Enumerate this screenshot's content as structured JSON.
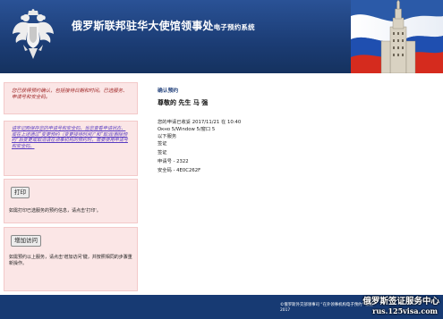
{
  "header": {
    "title_main": "俄罗斯联邦驻华大使馆领事处",
    "title_sub": "电子预约系统",
    "emblem_icon": "double-headed-eagle-icon",
    "flag_icon": "russian-flag-building-icon",
    "colors": {
      "header_bg": "#1b3c74",
      "flag_white": "#ffffff",
      "flag_blue": "#1f4fb0",
      "flag_red": "#d52b1e"
    }
  },
  "sidebar": {
    "notice": "您已获得预约确认，包括接待日期和时间。已选服务、申请号和安全码。",
    "edit_link": "请牢记刚保存您的申请号和安全码，当您查看申请状态、或在上述通过“变更预约（变更接待时间）”和“取消/删除预约”后变更或取消请在领事机构的预约时，需要使用申请号和安全码。",
    "print_button": "打印",
    "print_desc": "如需打印已选服务的预约信息，请点击'打印'。",
    "add_button": "增加访问",
    "add_desc": "如需预约以上服务，请点击'增加访问'键，并按照相同的步骤重新操作。"
  },
  "main": {
    "confirm_label": "确认预约",
    "greeting": "尊敬的 先生 马 强",
    "lines": [
      "您的申请已收妥 2017/11/21 在 10:40",
      "Окно 5/Window 5/窗口 5",
      "以下服务",
      "签证",
      "签证",
      "申请号 - 2322",
      "安全码 - 4E0C262F"
    ]
  },
  "footer": {
    "text_line1": "©俄罗斯外交部领事司 “在外领事机构电子预约” 系统",
    "text_line2": "2017"
  },
  "watermark": {
    "line1": "俄罗斯签证服务中心",
    "line2": "rus.125visa.com"
  }
}
